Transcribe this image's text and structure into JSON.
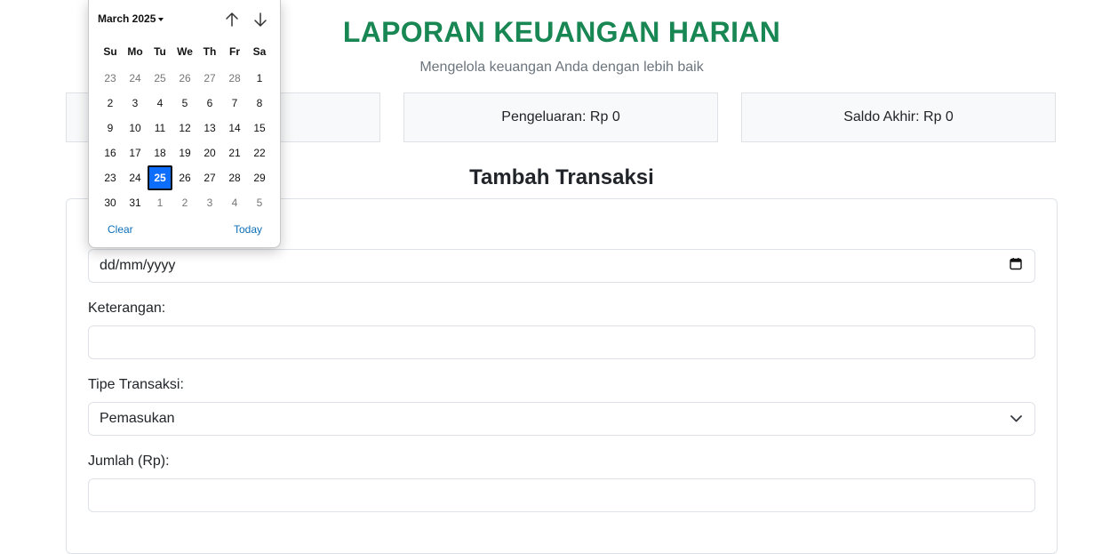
{
  "header": {
    "title": "LAPORAN KEUANGAN HARIAN",
    "subtitle": "Mengelola keuangan Anda dengan lebih baik"
  },
  "summary": {
    "pengeluaran": "Pengeluaran: Rp 0",
    "saldo": "Saldo Akhir: Rp 0"
  },
  "form": {
    "section_title": "Tambah Transaksi",
    "date_placeholder": "dd/mm/yyyy",
    "keterangan_label": "Keterangan:",
    "tipe_label": "Tipe Transaksi:",
    "tipe_selected": "Pemasukan",
    "jumlah_label": "Jumlah (Rp):"
  },
  "datepicker": {
    "month_label": "March 2025",
    "weekdays": [
      "Su",
      "Mo",
      "Tu",
      "We",
      "Th",
      "Fr",
      "Sa"
    ],
    "days": [
      {
        "d": "23",
        "muted": true
      },
      {
        "d": "24",
        "muted": true
      },
      {
        "d": "25",
        "muted": true
      },
      {
        "d": "26",
        "muted": true
      },
      {
        "d": "27",
        "muted": true
      },
      {
        "d": "28",
        "muted": true
      },
      {
        "d": "1"
      },
      {
        "d": "2"
      },
      {
        "d": "3"
      },
      {
        "d": "4"
      },
      {
        "d": "5"
      },
      {
        "d": "6"
      },
      {
        "d": "7"
      },
      {
        "d": "8"
      },
      {
        "d": "9"
      },
      {
        "d": "10"
      },
      {
        "d": "11"
      },
      {
        "d": "12"
      },
      {
        "d": "13"
      },
      {
        "d": "14"
      },
      {
        "d": "15"
      },
      {
        "d": "16"
      },
      {
        "d": "17"
      },
      {
        "d": "18"
      },
      {
        "d": "19"
      },
      {
        "d": "20"
      },
      {
        "d": "21"
      },
      {
        "d": "22"
      },
      {
        "d": "23"
      },
      {
        "d": "24"
      },
      {
        "d": "25",
        "selected": true
      },
      {
        "d": "26"
      },
      {
        "d": "27"
      },
      {
        "d": "28"
      },
      {
        "d": "29"
      },
      {
        "d": "30"
      },
      {
        "d": "31"
      },
      {
        "d": "1",
        "muted": true
      },
      {
        "d": "2",
        "muted": true
      },
      {
        "d": "3",
        "muted": true
      },
      {
        "d": "4",
        "muted": true
      },
      {
        "d": "5",
        "muted": true
      }
    ],
    "clear_label": "Clear",
    "today_label": "Today",
    "prev_icon": "arrow-up-icon",
    "next_icon": "arrow-down-icon"
  },
  "colors": {
    "title_green": "#198754",
    "selected_blue": "#0d6efd",
    "link_blue": "#0d6eb5"
  }
}
